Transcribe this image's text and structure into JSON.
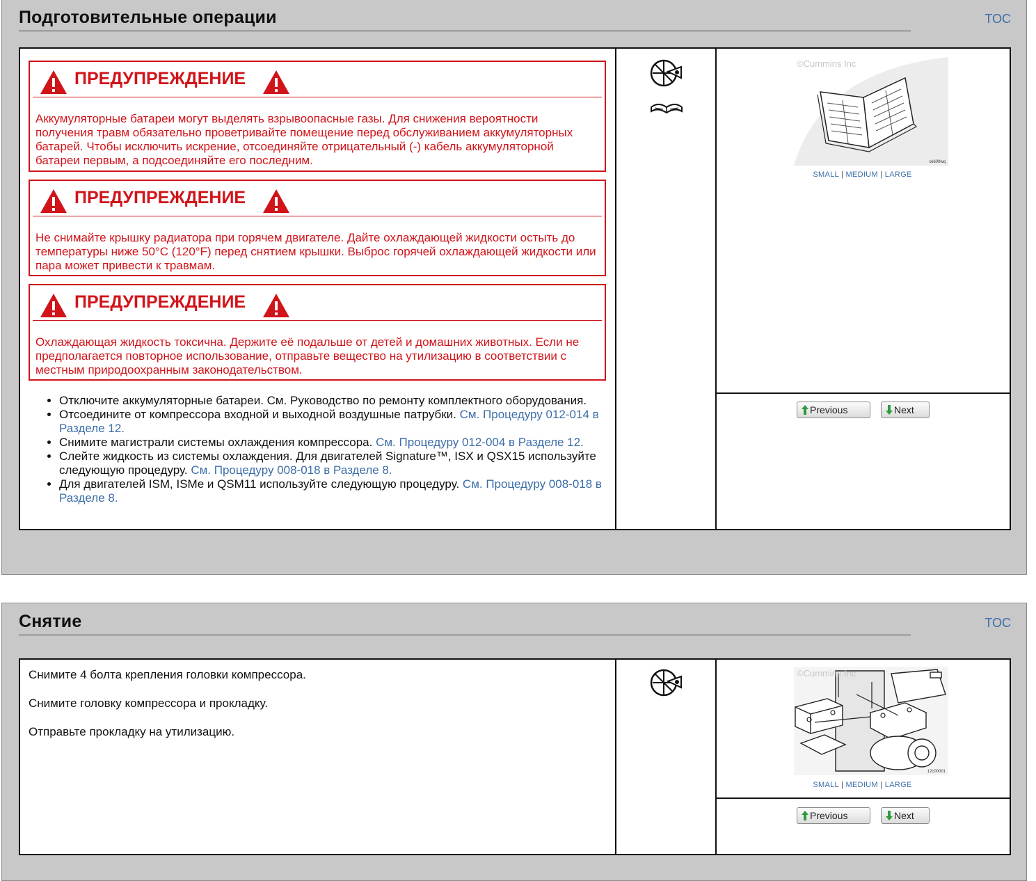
{
  "section1": {
    "title": "Подготовительные операции",
    "toc_label": "TOC",
    "warnings": [
      {
        "heading": "ПРЕДУПРЕЖДЕНИЕ",
        "text": "Аккумуляторные батареи могут выделять взрывоопасные газы. Для снижения вероятности получения травм обязательно проветривайте помещение перед обслуживанием аккумуляторных батарей. Чтобы исключить искрение, отсоединяйте отрицательный (-) кабель аккумуляторной батареи первым, а подсоединяйте его последним."
      },
      {
        "heading": "ПРЕДУПРЕЖДЕНИЕ",
        "text": "Не снимайте крышку радиатора при горячем двигателе. Дайте охлаждающей жидкости остыть до температуры ниже 50°C (120°F) перед снятием крышки. Выброс горячей охлаждающей жидкости или пара может привести к травмам."
      },
      {
        "heading": "ПРЕДУПРЕЖДЕНИЕ",
        "text": "Охлаждающая жидкость токсична. Держите её подальше от детей и домашних животных. Если не предполагается повторное использование, отправьте вещество на утилизацию в соответствии с местным природоохранным законодательством."
      }
    ],
    "steps": [
      {
        "text": "Отключите аккумуляторные батареи. См. Руководство по ремонту комплектного оборудования.",
        "link": ""
      },
      {
        "text": "Отсоедините от компрессора входной и выходной воздушные патрубки. ",
        "link": "См. Процедуру 012-014 в Разделе 12."
      },
      {
        "text": "Снимите магистрали системы охлаждения компрессора. ",
        "link": "См. Процедуру 012-004 в Разделе 12."
      },
      {
        "text": "Слейте жидкость из системы охлаждения. Для двигателей Signature™, ISX и QSX15 используйте следующую процедуру. ",
        "link": "См. Процедуру 008-018 в Разделе 8."
      },
      {
        "text": "Для двигателей ISM, ISMe и QSM11 используйте следующую процедуру. ",
        "link": "См. Процедуру 008-018 в Разделе 8."
      }
    ],
    "icons": [
      "time-estimate-icon",
      "manual-reference-icon"
    ],
    "figure": {
      "copyright": "©Cummins Inc",
      "code": "ck600wq",
      "icon": "open-manual-illustration"
    },
    "sizes": {
      "small": "SMALL",
      "medium": "MEDIUM",
      "large": "LARGE",
      "sep": "|"
    },
    "nav": {
      "previous": "Previous",
      "next": "Next"
    }
  },
  "section2": {
    "title": "Снятие",
    "toc_label": "TOC",
    "paragraphs": [
      "Снимите 4 болта крепления головки компрессора.",
      "Снимите головку компрессора и прокладку.",
      "Отправьте прокладку на утилизацию."
    ],
    "icons": [
      "time-estimate-icon"
    ],
    "figure": {
      "copyright": "©Cummins Inc",
      "code": "12c00001",
      "icon": "compressor-head-removal-illustration"
    },
    "sizes": {
      "small": "SMALL",
      "medium": "MEDIUM",
      "large": "LARGE",
      "sep": "|"
    },
    "nav": {
      "previous": "Previous",
      "next": "Next"
    }
  },
  "colors": {
    "warning": "#d0141a",
    "link": "#3c6ea8",
    "background": "#c8c8c8"
  }
}
